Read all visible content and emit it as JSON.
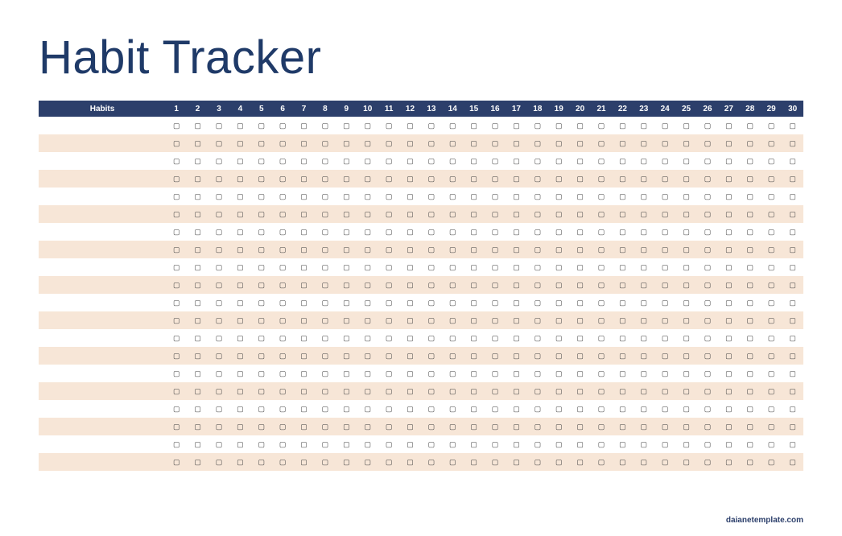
{
  "title": "Habit Tracker",
  "header_label": "Habits",
  "days": [
    "1",
    "2",
    "3",
    "4",
    "5",
    "6",
    "7",
    "8",
    "9",
    "10",
    "11",
    "12",
    "13",
    "14",
    "15",
    "16",
    "17",
    "18",
    "19",
    "20",
    "21",
    "22",
    "23",
    "24",
    "25",
    "26",
    "27",
    "28",
    "29",
    "30"
  ],
  "checkbox_glyph": "▢",
  "rows": [
    {
      "name": ""
    },
    {
      "name": ""
    },
    {
      "name": ""
    },
    {
      "name": ""
    },
    {
      "name": ""
    },
    {
      "name": ""
    },
    {
      "name": ""
    },
    {
      "name": ""
    },
    {
      "name": ""
    },
    {
      "name": ""
    },
    {
      "name": ""
    },
    {
      "name": ""
    },
    {
      "name": ""
    },
    {
      "name": ""
    },
    {
      "name": ""
    },
    {
      "name": ""
    },
    {
      "name": ""
    },
    {
      "name": ""
    },
    {
      "name": ""
    },
    {
      "name": ""
    }
  ],
  "footer": "daianetemplate.com"
}
